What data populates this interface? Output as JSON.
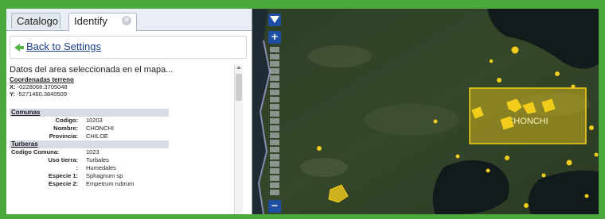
{
  "tabs": [
    {
      "label": "Catalogo"
    },
    {
      "label": "Identify"
    }
  ],
  "back_link": "Back to Settings",
  "intro": "Datos del area seleccionada en el mapa...",
  "coordinates": {
    "heading": "Coordenadas terreno",
    "x_label": "X:",
    "x_value": "-0228068.3705048",
    "y_label": "Y:",
    "y_value": "-5271460.3840509"
  },
  "comunas": {
    "heading": "Comunas",
    "rows": [
      {
        "label": "Codigo:",
        "value": "10203"
      },
      {
        "label": "Nombre:",
        "value": "CHONCHI"
      },
      {
        "label": "Provincia:",
        "value": "CHILOE"
      }
    ]
  },
  "turberas": {
    "heading": "Turberas",
    "rows": [
      {
        "label": "Codigo Comuna:",
        "value": "1023"
      },
      {
        "label": "Uso tierra:",
        "value": "Turbales"
      },
      {
        "label": ":",
        "value": "Humedales"
      },
      {
        "label": "Especie 1:",
        "value": "Sphagnum sp"
      },
      {
        "label": "Especie 2:",
        "value": "Empetrum rubrum"
      }
    ]
  },
  "map": {
    "selection_label": "CHONCHI",
    "highlight_color": "#f2cc1a",
    "zoom_in_icon": "+",
    "zoom_out_icon": "−"
  }
}
